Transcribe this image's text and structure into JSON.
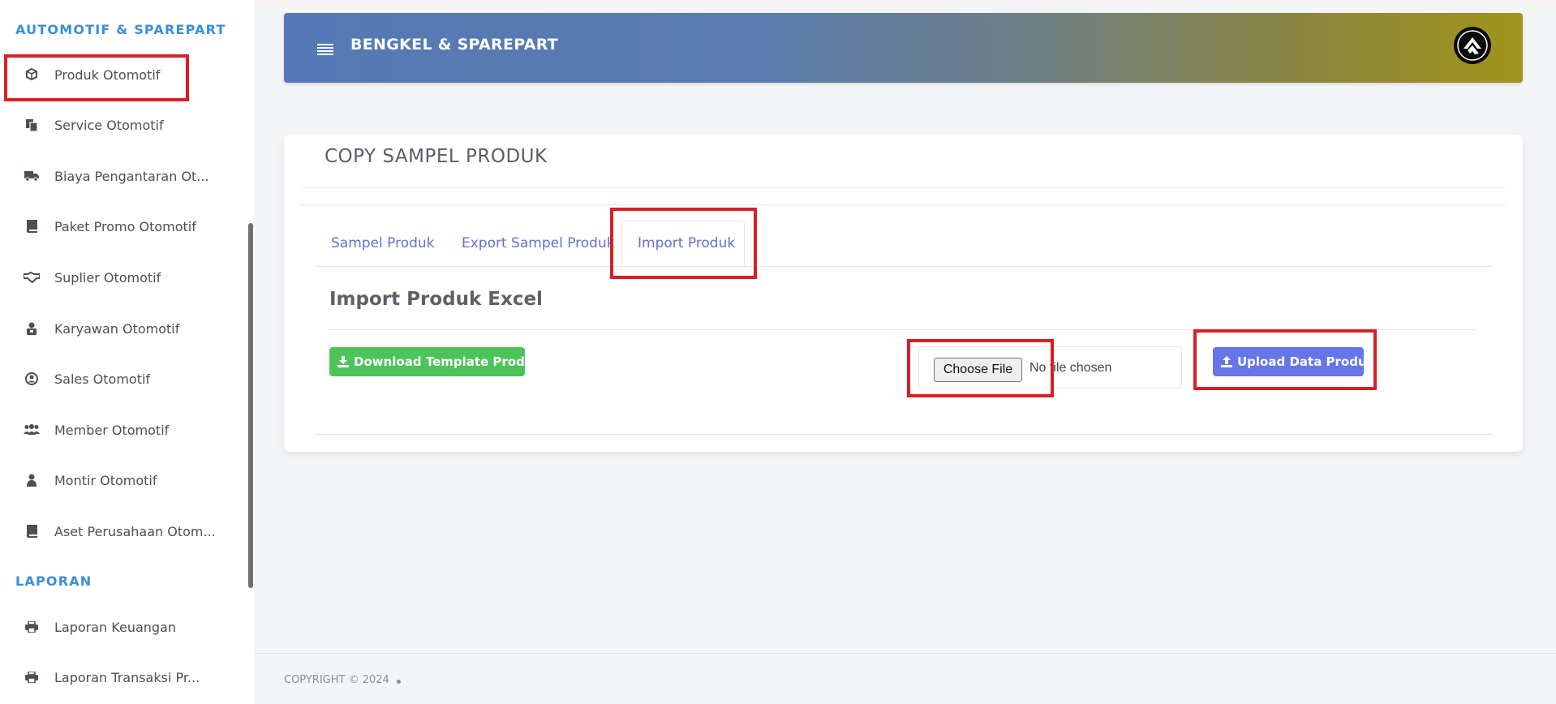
{
  "sidebar": {
    "section1": "AUTOMOTIF & SPAREPART",
    "section2": "LAPORAN",
    "items": [
      {
        "label": "Produk Otomotif",
        "icon": "cube-icon"
      },
      {
        "label": "Service Otomotif",
        "icon": "copy-icon"
      },
      {
        "label": "Biaya Pengantaran Ot...",
        "icon": "truck-icon"
      },
      {
        "label": "Paket Promo Otomotif",
        "icon": "book-icon"
      },
      {
        "label": "Suplier Otomotif",
        "icon": "handshake-icon"
      },
      {
        "label": "Karyawan Otomotif",
        "icon": "user-lock-icon"
      },
      {
        "label": "Sales Otomotif",
        "icon": "user-circle-icon"
      },
      {
        "label": "Member Otomotif",
        "icon": "users-icon"
      },
      {
        "label": "Montir Otomotif",
        "icon": "user-icon"
      },
      {
        "label": "Aset Perusahaan Otom...",
        "icon": "book-icon"
      }
    ],
    "report_items": [
      {
        "label": "Laporan Keuangan",
        "icon": "print-icon"
      },
      {
        "label": "Laporan Transaksi Pr...",
        "icon": "print-icon"
      }
    ]
  },
  "header": {
    "title": "BENGKEL & SPAREPART"
  },
  "card": {
    "title": "COPY SAMPEL PRODUK",
    "tabs": [
      "Sampel Produk",
      "Export Sampel Produk",
      "Import Produk"
    ],
    "active_tab": "Import Produk",
    "section_title": "Import Produk Excel",
    "download_button": "Download Template Produk",
    "file_button": "Choose File",
    "file_status": "No file chosen",
    "upload_button": "Upload Data Produk"
  },
  "footer": {
    "copyright": "COPYRIGHT © 2024"
  },
  "colors": {
    "accent": "#3a8fd9",
    "tab_text": "#6470d4",
    "green_button": "#4cc45a",
    "blue_button": "#6675e8",
    "highlight": "#d81f26"
  }
}
